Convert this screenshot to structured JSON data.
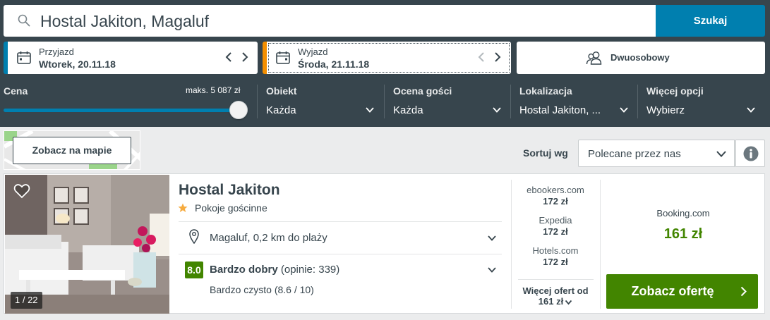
{
  "search": {
    "query": "Hostal Jakiton, Magaluf",
    "button_label": "Szukaj"
  },
  "dates": {
    "checkin": {
      "label": "Przyjazd",
      "value": "Wtorek, 20.11.18"
    },
    "checkout": {
      "label": "Wyjazd",
      "value": "Środa, 21.11.18"
    }
  },
  "room": {
    "label": "Dwuosobowy"
  },
  "filters": {
    "price": {
      "label": "Cena",
      "max_label": "maks. 5 087 zł",
      "slider_level": 1.0
    },
    "property": {
      "label": "Obiekt",
      "value": "Każda"
    },
    "guest_rating": {
      "label": "Ocena gości",
      "value": "Każda"
    },
    "location": {
      "label": "Lokalizacja",
      "value": "Hostal Jakiton, ..."
    },
    "more": {
      "label": "Więcej opcji",
      "value": "Wybierz"
    }
  },
  "map": {
    "button_label": "Zobacz na mapie"
  },
  "sort": {
    "label": "Sortuj wg",
    "value": "Polecane przez nas"
  },
  "result": {
    "name": "Hostal Jakiton",
    "type": "Pokoje gościnne",
    "stars": 1,
    "location": "Magaluf, 0,2 km do plaży",
    "rating_score": "8.0",
    "rating_label": "Bardzo dobry",
    "rating_count": "(opinie: 339)",
    "rating_detail": "Bardzo czysto (8.6 / 10)",
    "photo_counter": "1 / 22",
    "providers": [
      {
        "name": "ebookers.com",
        "price": "172 zł"
      },
      {
        "name": "Expedia",
        "price": "172 zł"
      },
      {
        "name": "Hotels.com",
        "price": "172 zł"
      }
    ],
    "more_offers_label": "Więcej ofert od",
    "more_offers_price": "161 zł",
    "best_provider": "Booking.com",
    "best_price": "161 zł",
    "deal_button_label": "Zobacz ofertę"
  },
  "colors": {
    "panel": "#37454d",
    "primary_blue": "#007faf",
    "checkout_accent": "#f48f00",
    "deal_green": "#428500"
  }
}
